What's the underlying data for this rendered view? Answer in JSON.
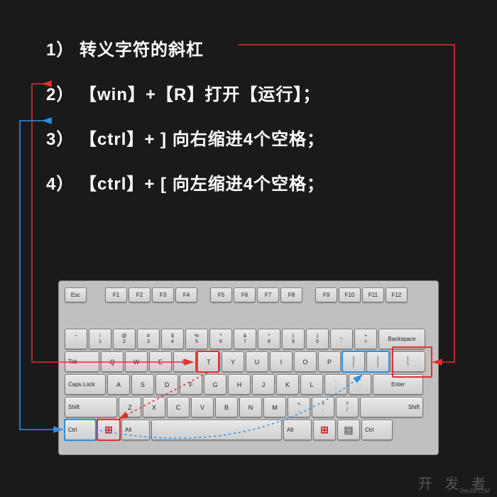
{
  "text": {
    "l1": "1） 转义字符的斜杠",
    "l2": "2） 【win】+【R】打开【运行】；",
    "l3": "3） 【ctrl】+  ] 向右缩进4个空格；",
    "l4": "4） 【ctrl】+  [ 向左缩进4个空格；"
  },
  "watermark": "开 发 者",
  "watermark_url": "DevZe.CoM",
  "keys": {
    "esc": "Esc",
    "f1": "F1",
    "f2": "F2",
    "f3": "F3",
    "f4": "F4",
    "f5": "F5",
    "f6": "F6",
    "f7": "F7",
    "f8": "F8",
    "f9": "F9",
    "f10": "F10",
    "f11": "F11",
    "f12": "F12",
    "tilde_top": "~",
    "tilde_bot": "`",
    "n1t": "!",
    "n1b": "1",
    "n2t": "@",
    "n2b": "2",
    "n3t": "#",
    "n3b": "3",
    "n4t": "$",
    "n4b": "4",
    "n5t": "%",
    "n5b": "5",
    "n6t": "^",
    "n6b": "6",
    "n7t": "&",
    "n7b": "7",
    "n8t": "*",
    "n8b": "8",
    "n9t": "(",
    "n9b": "9",
    "n0t": ")",
    "n0b": "0",
    "mint": "_",
    "minb": "-",
    "eqt": "+",
    "eqb": "=",
    "bksp": "Backspace",
    "tab": "Tab",
    "Q": "Q",
    "W": "W",
    "E": "E",
    "R": "R",
    "T": "T",
    "Y": "Y",
    "U": "U",
    "I": "I",
    "O": "O",
    "P": "P",
    "lbrk_t": "{",
    "lbrk_b": "[",
    "rbrk_t": "}",
    "rbrk_b": "]",
    "bslash_t": "|",
    "bslash_b": "\\",
    "caps": "Caps Lock",
    "A": "A",
    "S": "S",
    "D": "D",
    "F": "F",
    "G": "G",
    "H": "H",
    "J": "J",
    "K": "K",
    "L": "L",
    "semi_t": ":",
    "semi_b": ";",
    "quot_t": "\"",
    "quot_b": "'",
    "enter": "Enter",
    "lshift": "Shift",
    "Z": "Z",
    "X": "X",
    "C": "C",
    "V": "V",
    "B": "B",
    "N": "N",
    "M": "M",
    "com_t": "<",
    "com_b": ",",
    "per_t": ">",
    "per_b": ".",
    "sl_t": "?",
    "sl_b": "/",
    "rshift": "Shift",
    "ctrl": "Ctrl",
    "alt": "Alt",
    "menu": "▤"
  },
  "icons": {
    "win": "⊞"
  },
  "colors": {
    "red": "#e03030",
    "blue": "#3090e0",
    "bg": "#1a1a1a"
  }
}
